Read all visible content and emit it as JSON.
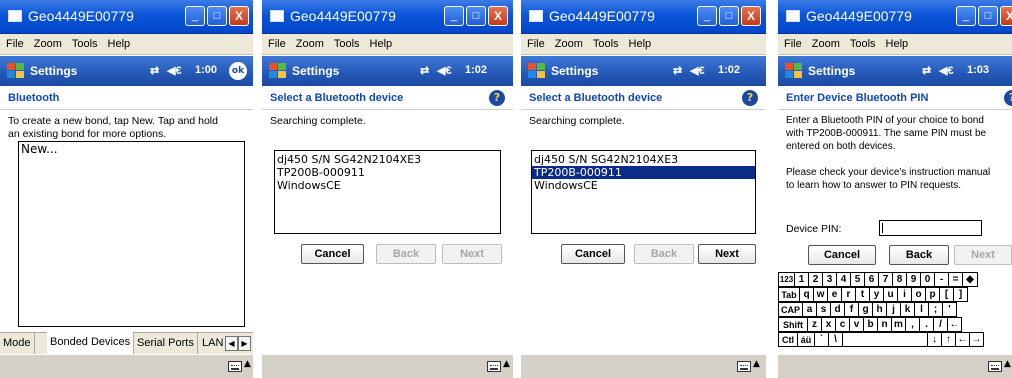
{
  "colors": {
    "title_blue": "#0a55d8",
    "heading_blue": "#1146b8",
    "selection": "#0b2c86",
    "close_red": "#c63a15"
  },
  "window": {
    "title": "Geo4449E00779",
    "minimize": "_",
    "maximize": "□",
    "close": "X"
  },
  "menu": [
    "File",
    "Zoom",
    "Tools",
    "Help"
  ],
  "pda": {
    "app": "Settings",
    "connectivity_icon": "connectivity-arrows",
    "volume": "◀€"
  },
  "panel1": {
    "time": "1:00",
    "ok": "ok",
    "heading": "Bluetooth",
    "instructions": [
      "To create a new bond, tap New. Tap and hold",
      "an existing bond for more options."
    ],
    "list": [
      "New..."
    ],
    "tabs": [
      "Mode",
      "Bonded Devices",
      "Serial Ports",
      "LAN"
    ],
    "active_tab": "Bonded Devices",
    "tab_scroll": [
      "◀",
      "▶"
    ]
  },
  "panel2": {
    "time": "1:02",
    "heading": "Select a Bluetooth device",
    "help": "?",
    "status_text": "Searching complete.",
    "devices": [
      "dj450 S/N SG42N2104XE3",
      "TP200B-000911",
      "WindowsCE"
    ],
    "selected": null,
    "buttons": {
      "cancel": "Cancel",
      "back": "Back",
      "next": "Next"
    }
  },
  "panel3": {
    "time": "1:02",
    "heading": "Select a Bluetooth device",
    "help": "?",
    "status_text": "Searching complete.",
    "devices": [
      "dj450 S/N SG42N2104XE3",
      "TP200B-000911",
      "WindowsCE"
    ],
    "selected": "TP200B-000911",
    "buttons": {
      "cancel": "Cancel",
      "back": "Back",
      "next": "Next"
    }
  },
  "panel4": {
    "time": "1:03",
    "heading": "Enter Device Bluetooth PIN",
    "help": "?",
    "para1": [
      "Enter a Bluetooth PIN of your choice to bond",
      "with TP200B-000911. The same PIN must be",
      "entered on both devices."
    ],
    "para2": [
      "Please check your device's instruction manual",
      "to learn how to answer to PIN requests."
    ],
    "pin_label": "Device PIN:",
    "pin_value": "",
    "buttons": {
      "cancel": "Cancel",
      "back": "Back",
      "next": "Next"
    },
    "keyboard": {
      "row1": [
        "123",
        "1",
        "2",
        "3",
        "4",
        "5",
        "6",
        "7",
        "8",
        "9",
        "0",
        "-",
        "=",
        "◆"
      ],
      "row2": [
        "Tab",
        "q",
        "w",
        "e",
        "r",
        "t",
        "y",
        "u",
        "i",
        "o",
        "p",
        "[",
        "]"
      ],
      "row3": [
        "CAP",
        "a",
        "s",
        "d",
        "f",
        "g",
        "h",
        "j",
        "k",
        "l",
        ";",
        "'"
      ],
      "row4": [
        "Shift",
        "z",
        "x",
        "c",
        "v",
        "b",
        "n",
        "m",
        ",",
        ".",
        "/",
        "←"
      ],
      "row5": [
        "Ctl",
        "áü",
        "`",
        "\\",
        "",
        "↓",
        "↑",
        "←",
        "→"
      ]
    }
  }
}
